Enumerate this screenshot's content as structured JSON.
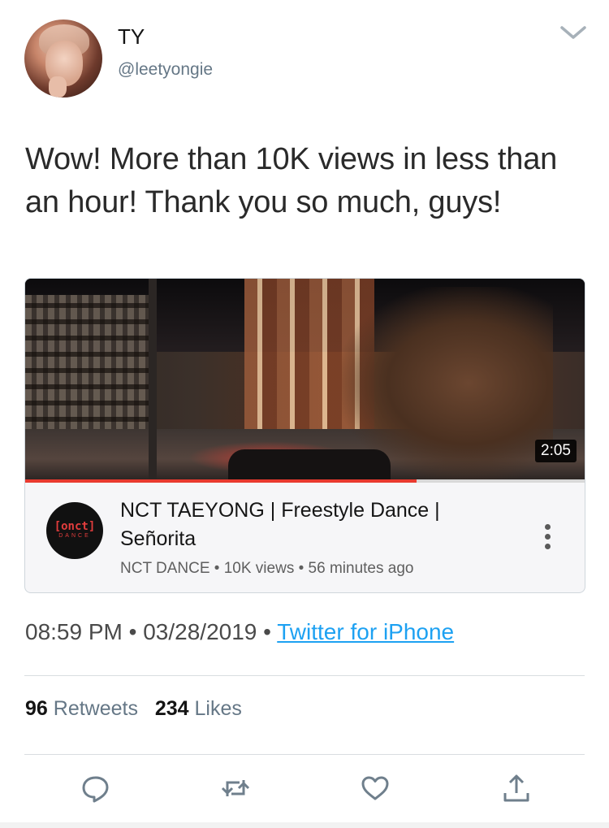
{
  "user": {
    "name": "TY",
    "handle": "@leetyongie"
  },
  "tweet": {
    "text": "Wow! More than 10K views in less than an hour! Thank you so much, guys!",
    "time": "08:59 PM",
    "sep": "•",
    "date": "03/28/2019",
    "source": "Twitter for iPhone"
  },
  "card": {
    "duration": "2:05",
    "channel_logo_top": "[onct]",
    "channel_logo_bottom": "DANCE",
    "title": "NCT TAEYONG | Freestyle Dance | Señorita",
    "channel": "NCT DANCE",
    "views": "10K views",
    "age": "56 minutes ago",
    "progress_fraction": 0.7,
    "accent": "#e93a2f"
  },
  "stats": {
    "retweets_count": "96",
    "retweets_label": "Retweets",
    "likes_count": "234",
    "likes_label": "Likes"
  },
  "actions": [
    "reply-icon",
    "retweet-icon",
    "like-icon",
    "share-icon"
  ],
  "colors": {
    "link": "#1da1f2",
    "secondary_text": "#657786"
  }
}
